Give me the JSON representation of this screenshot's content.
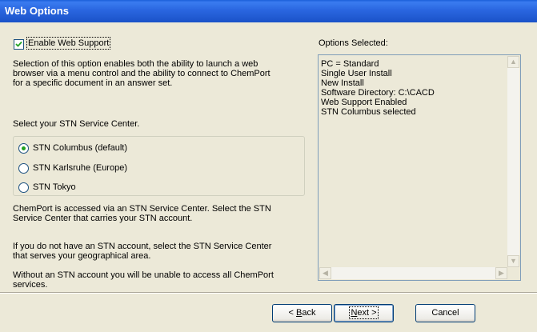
{
  "window": {
    "title": "Web Options"
  },
  "enable_web_support": {
    "label": "Enable Web Support",
    "checked": true
  },
  "description": [
    "Selection of this option enables both the ability to launch a web",
    "browser via a menu control and the ability to connect to ChemPort",
    "for a specific document in an answer set."
  ],
  "service_center_prompt": "Select your STN Service Center.",
  "service_centers": [
    {
      "label": "STN Columbus (default)",
      "selected": true
    },
    {
      "label": "STN Karlsruhe (Europe)",
      "selected": false
    },
    {
      "label": "STN Tokyo",
      "selected": false
    }
  ],
  "info_1": [
    "ChemPort is accessed via an STN Service Center. Select the STN",
    "Service Center that carries your STN account."
  ],
  "info_2": [
    "If you do not have an STN account, select the STN Service Center",
    "that serves your geographical area."
  ],
  "info_3": [
    "Without an STN account you will be unable to access all ChemPort",
    "services."
  ],
  "options_selected": {
    "label": "Options Selected:",
    "items": [
      "PC = Standard",
      "Single User Install",
      "New Install",
      "Software Directory: C:\\CACD",
      "Web Support Enabled",
      "STN Columbus selected"
    ]
  },
  "buttons": {
    "back_accel": "B",
    "back_rest": "ack",
    "next_accel": "N",
    "next_rest": "ext >",
    "cancel": "Cancel"
  }
}
